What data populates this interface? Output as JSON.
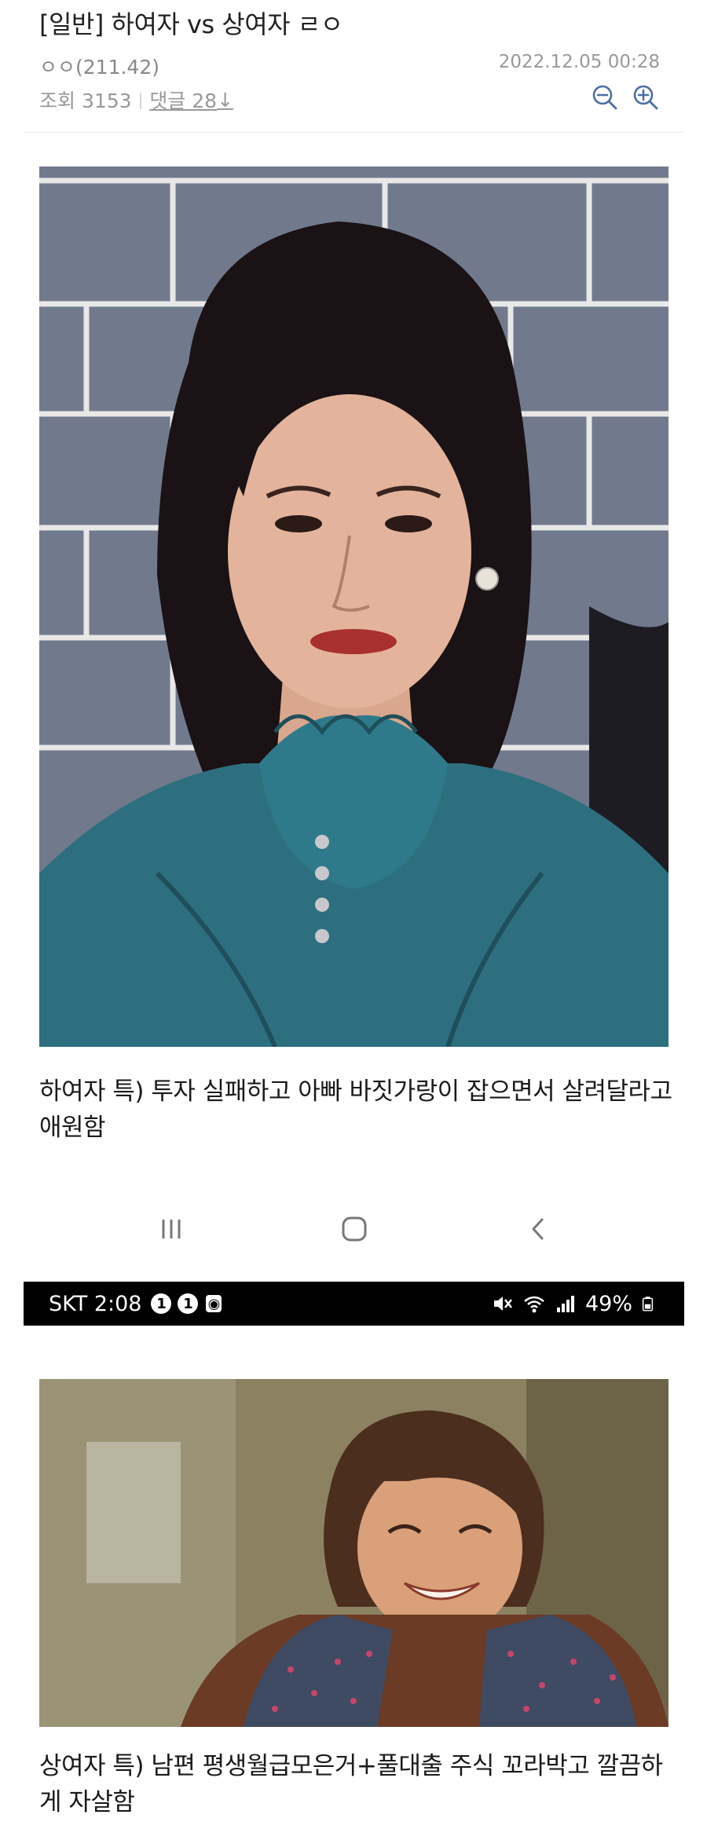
{
  "post": {
    "title": "[일반] 하여자 vs 상여자 ㄹㅇ",
    "author": "ㅇㅇ(211.42)",
    "date": "2022.12.05 00:28",
    "views_label": "조회 3153",
    "comments_label": "댓글 28",
    "comments_arrow": "↓"
  },
  "content": {
    "caption1": "하여자 특) 투자 실패하고 아빠 바짓가랑이 잡으면서 살려달라고 애원함",
    "caption2": "상여자 특) 남편 평생월급모은거+풀대출 주식 꼬라박고 깔끔하게 자살함"
  },
  "statusbar": {
    "carrier_time": "SKT 2:08",
    "notif1": "1",
    "notif2": "1",
    "battery": "49%"
  },
  "icons": {
    "zoom_out": "zoom-out-icon",
    "zoom_in": "zoom-in-icon",
    "nav_recent": "recent-apps-icon",
    "nav_home": "home-icon",
    "nav_back": "back-icon"
  }
}
